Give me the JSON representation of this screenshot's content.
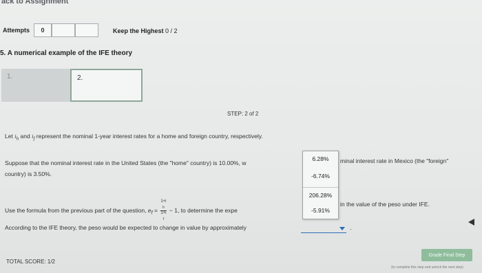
{
  "header": {
    "back_link": "ack to Assignment"
  },
  "attempts": {
    "label": "Attempts",
    "value": "0",
    "keep_highest_label": "Keep the Highest",
    "keep_highest_value": "0 / 2"
  },
  "section": {
    "title": "5. A numerical example of the IFE theory"
  },
  "steps": {
    "tabs": [
      {
        "label": "1."
      },
      {
        "label": "2."
      }
    ],
    "indicator": "STEP: 2 of 2"
  },
  "question": {
    "intro_prefix": "Let",
    "intro_ih": "i",
    "intro_ih_sub": "h",
    "intro_mid": "and",
    "intro_if": "i",
    "intro_if_sub": "f",
    "intro_suffix": "represent the nominal 1-year interest rates for a home and foreign country, respectively.",
    "suppose_text": "Suppose that the nominal interest rate in the United States (the \"home\" country) is 10.00%, w",
    "suppose_text_line2": "country) is 3.50%.",
    "suppose_right": "minal interest rate in Mexico (the \"foreign\"",
    "formula_prefix": "Use the formula from the previous part of the question,",
    "formula_var": "e",
    "formula_var_sub": "f",
    "formula_eq": "=",
    "formula_num": "1+i",
    "formula_num_sub": "h",
    "formula_den": "1+i",
    "formula_den_sub": "f",
    "formula_suffix": "− 1, to determine the expe",
    "formula_right": "in the value of the peso under IFE.",
    "according_text": "According to the IFE theory, the peso would be expected to change in value by approximately",
    "period": "."
  },
  "dropdown": {
    "options": [
      "6.28%",
      "-6.74%",
      "206.28%",
      "-5.91%"
    ],
    "selected": ""
  },
  "footer": {
    "total_score": "TOTAL SCORE: 1/2",
    "grade_button": "Grade Final Step",
    "grade_note": "(to complete this step and unlock the next step)"
  },
  "colors": {
    "accent_blue": "#2a6db5",
    "grade_green": "#8fbd9c"
  }
}
